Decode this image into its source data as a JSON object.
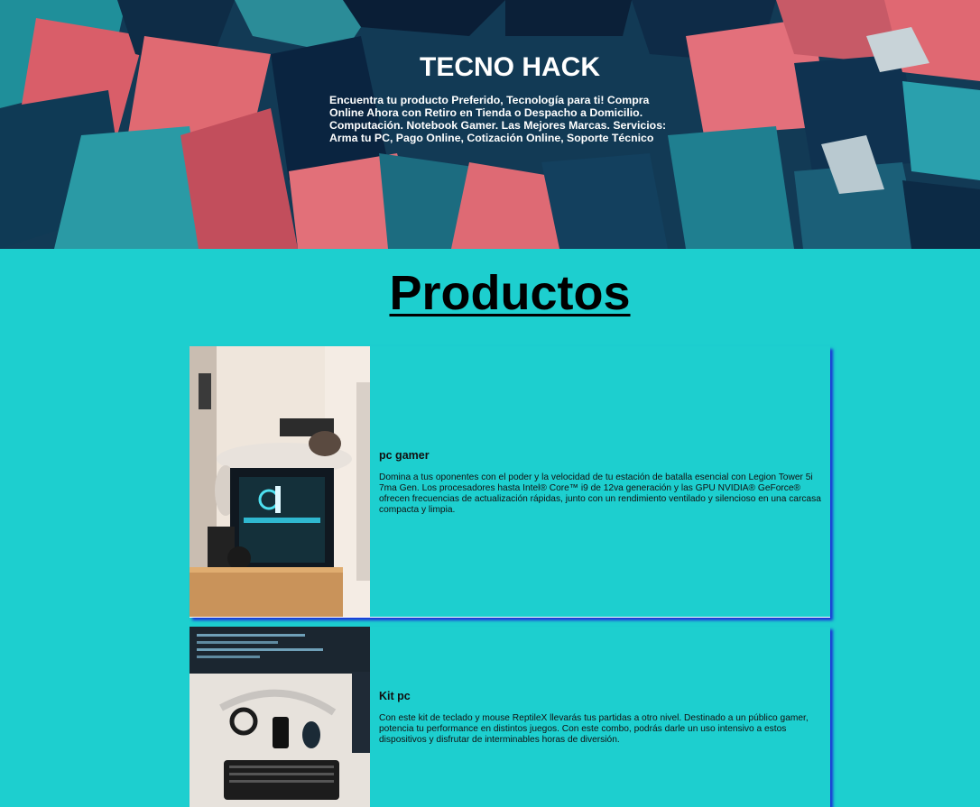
{
  "header": {
    "title": "TECNO HACK",
    "description": "Encuentra tu producto Preferido, Tecnología para ti! Compra Online Ahora con Retiro en Tienda o Despacho a Domicilio. Computación. Notebook Gamer. Las Mejores Marcas. Servicios: Arma tu PC, Pago Online, Cotización Online, Soporte Técnico"
  },
  "products_section": {
    "title": "Productos",
    "items": [
      {
        "name": "pc gamer",
        "description": "Domina a tus oponentes con el poder y la velocidad de tu estación de batalla esencial con Legion Tower 5i 7ma Gen. Los procesadores hasta Intel® Core™ i9 de 12va generación y las GPU NVIDIA® GeForce® ofrecen frecuencias de actualización rápidas, junto con un rendimiento ventilado y silencioso en una carcasa compacta y limpia."
      },
      {
        "name": "Kit pc",
        "description": "Con este kit de teclado y mouse ReptileX llevarás tus partidas a otro nivel. Destinado a un público gamer, potencia tu performance en distintos juegos. Con este combo, podrás darle un uso intensivo a estos dispositivos y disfrutar de interminables horas de diversión."
      }
    ]
  },
  "colors": {
    "page_background": "#1dcfcf",
    "card_shadow": "#1a33d6",
    "hero_dark": "#0f3550",
    "hero_coral": "#e0616a",
    "hero_teal": "#2a8f9c"
  }
}
